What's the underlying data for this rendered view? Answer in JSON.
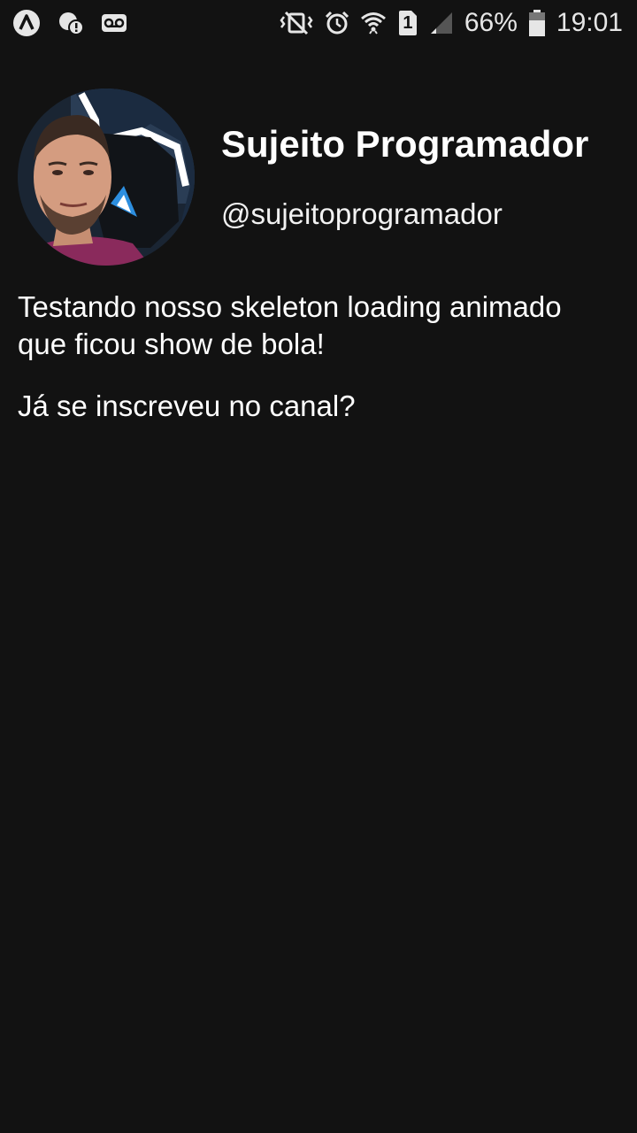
{
  "status_bar": {
    "battery_percent": "66%",
    "time": "19:01",
    "sim_slot": "1",
    "icons": [
      "app-a-icon",
      "notification-icon",
      "voicemail-icon",
      "vibrate-mute-icon",
      "alarm-icon",
      "wifi-icon",
      "sim-icon",
      "signal-icon",
      "battery-icon"
    ],
    "battery_level": 0.66
  },
  "profile": {
    "name": "Sujeito Programador",
    "handle": "@sujeitoprogramador"
  },
  "post": {
    "paragraphs": [
      "Testando nosso skeleton loading animado que ficou show de bola!",
      "Já se inscreveu no canal?"
    ]
  },
  "colors": {
    "background": "#121212",
    "text": "#ffffff"
  }
}
